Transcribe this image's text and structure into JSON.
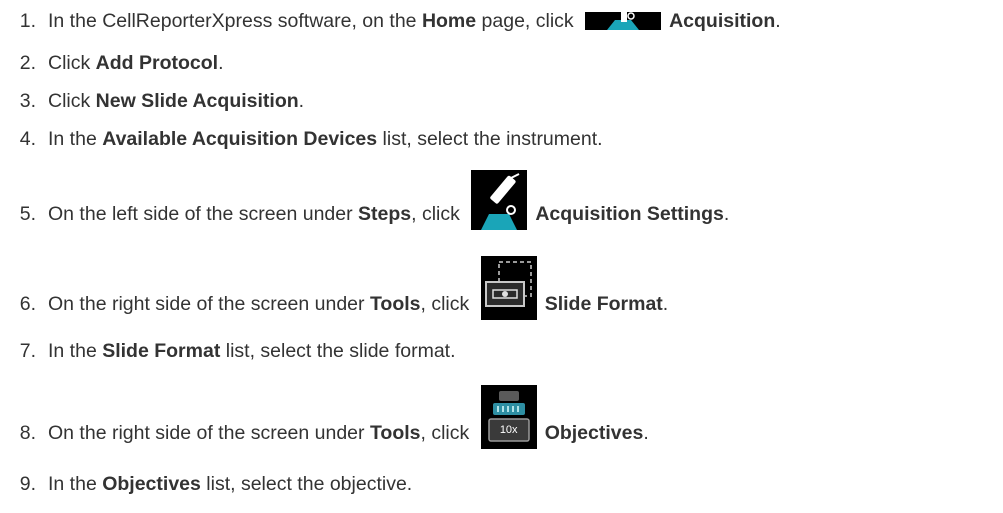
{
  "steps": [
    {
      "number": "1.",
      "pre": "In the CellReporterXpress software, on the ",
      "b1": "Home",
      "mid": " page, click ",
      "icon": "acquisition-icon",
      "b2": "Acquisition",
      "post": "."
    },
    {
      "number": "2.",
      "pre": "Click ",
      "b1": "Add Protocol",
      "post": "."
    },
    {
      "number": "3.",
      "pre": "Click ",
      "b1": "New Slide Acquisition",
      "post": "."
    },
    {
      "number": "4.",
      "pre": "In the ",
      "b1": "Available Acquisition Devices",
      "post": " list, select the instrument."
    },
    {
      "number": "5.",
      "pre": "On the left side of the screen under ",
      "b1": "Steps",
      "mid": ", click ",
      "icon": "acquisition-settings-icon",
      "b2": "Acquisition Settings",
      "post": "."
    },
    {
      "number": "6.",
      "pre": "On the right side of the screen under ",
      "b1": "Tools",
      "mid": ", click ",
      "icon": "slide-format-icon",
      "b2": "Slide Format",
      "post": "."
    },
    {
      "number": "7.",
      "pre": "In the ",
      "b1": "Slide Format",
      "post": " list, select the slide format."
    },
    {
      "number": "8.",
      "pre": "On the right side of the screen under ",
      "b1": "Tools",
      "mid": ", click ",
      "icon": "objectives-icon",
      "icon_text": "10x",
      "b2": "Objectives",
      "post": "."
    },
    {
      "number": "9.",
      "pre": "In the ",
      "b1": "Objectives",
      "post": " list, select the objective."
    }
  ]
}
